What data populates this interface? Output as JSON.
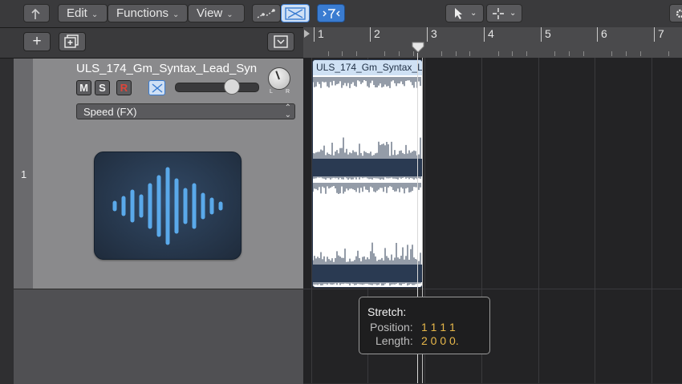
{
  "topbar": {
    "menus": [
      "Edit",
      "Functions",
      "View"
    ]
  },
  "ruler": {
    "bars": [
      "1",
      "2",
      "3",
      "4",
      "5",
      "6",
      "7"
    ]
  },
  "track": {
    "number": "1",
    "name": "ULS_174_Gm_Syntax_Lead_Syn",
    "mute_label": "M",
    "solo_label": "S",
    "record_label": "R",
    "pan_left": "L",
    "pan_right": "R",
    "flex_mode": "Speed (FX)",
    "volume_level": 0.72
  },
  "region": {
    "name": "ULS_174_Gm_Syntax_L"
  },
  "tooltip": {
    "title": "Stretch:",
    "position_label": "Position:",
    "position_value": "1 1 1 1",
    "length_label": "Length:",
    "length_value": "2 0 0 0."
  },
  "colors": {
    "accent_blue": "#3a7cd1",
    "tooltip_value": "#e8b84a",
    "record_red": "#e0453a",
    "waveform_icon": "#5aa9ea"
  }
}
